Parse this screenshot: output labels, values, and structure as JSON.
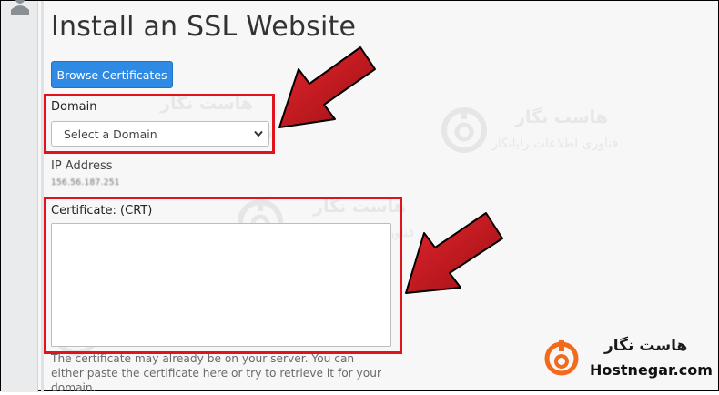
{
  "page": {
    "title": "Install an SSL Website",
    "browse_button": "Browse Certificates"
  },
  "domain": {
    "label": "Domain",
    "select_value": "Select a Domain"
  },
  "ip": {
    "label": "IP Address",
    "value": "156.56.187.251"
  },
  "certificate": {
    "label": "Certificate: (CRT)",
    "value": "",
    "help": "The certificate may already be on your server. You can either paste the certificate here or try to retrieve it for your domain."
  },
  "watermark": {
    "title": "هاست نگار",
    "subtitle": "فناوری اطلاعات رایانگار"
  },
  "brand": {
    "title": "هاست نگار",
    "site": "Hostnegar.com"
  },
  "colors": {
    "accent": "#2f8ae4",
    "highlight": "#e1141c",
    "arrow": "#c8161d",
    "brand_orange": "#f26b1d"
  }
}
